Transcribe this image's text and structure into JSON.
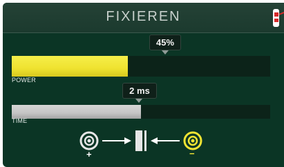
{
  "header": {
    "title": "FIXIEREN",
    "tool_icon": "fixing-tool-icon"
  },
  "power": {
    "label": "POWER",
    "value_text": "45%",
    "level": 0.45,
    "color": "#f0e433"
  },
  "time": {
    "label": "TIME",
    "value_text": "2 ms",
    "level": 0.5,
    "color": "#c4c4c4"
  },
  "diagram": {
    "plus_symbol": "+",
    "minus_symbol": "−",
    "plus_color": "#e6e6e6",
    "minus_color": "#f0e433",
    "icons": [
      "positive-electrode-icon",
      "arrow-right-icon",
      "workpiece-icon",
      "arrow-left-icon",
      "negative-electrode-icon"
    ]
  }
}
